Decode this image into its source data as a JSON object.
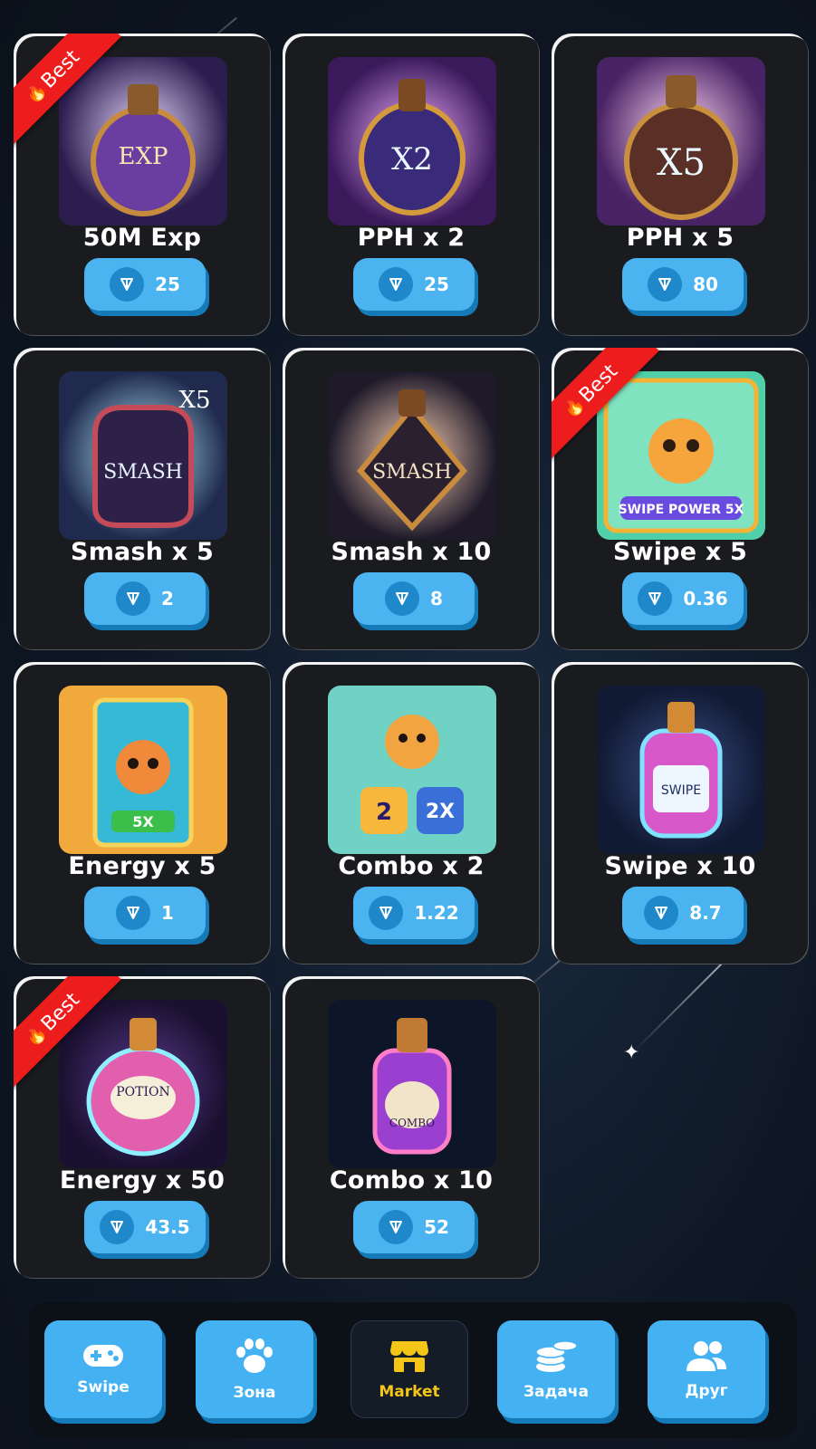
{
  "items": [
    {
      "name": "50M Exp",
      "price": "25",
      "badge": "Best"
    },
    {
      "name": "PPH x 2",
      "price": "25",
      "badge": ""
    },
    {
      "name": "PPH x 5",
      "price": "80",
      "badge": ""
    },
    {
      "name": "Smash x 5",
      "price": "2",
      "badge": ""
    },
    {
      "name": "Smash x 10",
      "price": "8",
      "badge": ""
    },
    {
      "name": "Swipe x 5",
      "price": "0.36",
      "badge": "Best"
    },
    {
      "name": "Energy x 5",
      "price": "1",
      "badge": ""
    },
    {
      "name": "Combo x 2",
      "price": "1.22",
      "badge": ""
    },
    {
      "name": "Swipe x 10",
      "price": "8.7",
      "badge": ""
    },
    {
      "name": "Energy x 50",
      "price": "43.5",
      "badge": "Best"
    },
    {
      "name": "Combo x 10",
      "price": "52",
      "badge": ""
    }
  ],
  "nav": {
    "swipe": "Swipe",
    "zone": "Зона",
    "market": "Market",
    "tasks": "Задача",
    "friends": "Друг"
  },
  "colors": {
    "accent": "#4ab3f0",
    "accent_shadow": "#157ab8",
    "badge": "#ee1d1d",
    "active_nav": "#f5c518"
  },
  "icons": {
    "currency": "ton-icon",
    "nav_swipe": "gamepad-icon",
    "nav_zone": "paw-icon",
    "nav_market": "store-icon",
    "nav_tasks": "coins-icon",
    "nav_friends": "users-icon"
  }
}
